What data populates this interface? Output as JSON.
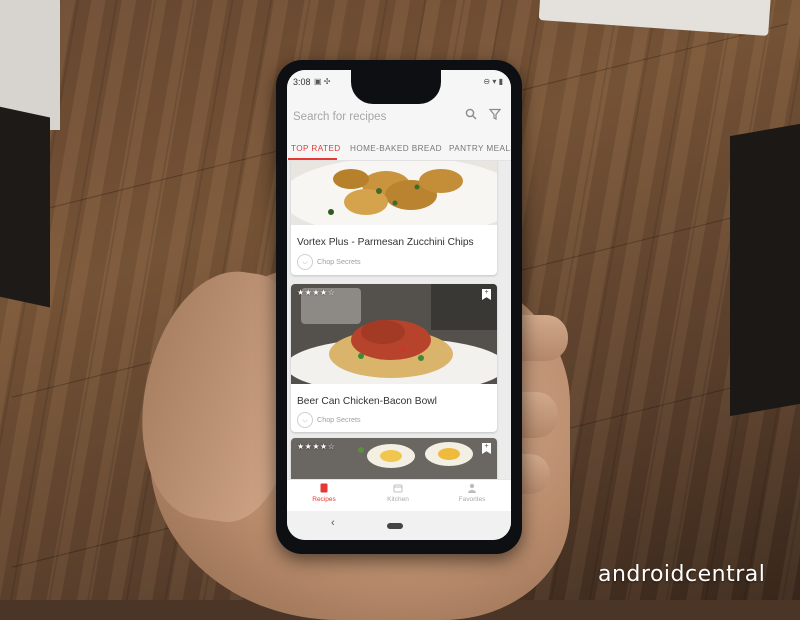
{
  "watermark": "androidcentral",
  "status_bar": {
    "time": "3:08",
    "left_icons": "▣ ✣",
    "right_icons": "⊖ ▾ ▮"
  },
  "search": {
    "placeholder": "Search for recipes"
  },
  "tabs": [
    {
      "label": "TOP RATED",
      "active": true
    },
    {
      "label": "HOME-BAKED BREAD",
      "active": false
    },
    {
      "label": "PANTRY MEALS",
      "active": false
    }
  ],
  "recipes": [
    {
      "title": "Vortex Plus - Parmesan Zucchini Chips",
      "author": "Chop Secrets"
    },
    {
      "title": "Beer Can Chicken-Bacon Bowl",
      "author": "Chop Secrets",
      "rating": "★★★★☆"
    },
    {
      "title": "",
      "author": "",
      "rating": "★★★★☆"
    }
  ],
  "bottom_nav": [
    {
      "label": "Recipes",
      "icon": "recipes-icon",
      "active": true
    },
    {
      "label": "Kitchen",
      "icon": "kitchen-icon",
      "active": false
    },
    {
      "label": "Favorites",
      "icon": "favorites-icon",
      "active": false
    }
  ],
  "system_nav": {
    "back": "‹"
  },
  "colors": {
    "accent": "#e53935",
    "screen_bg": "#f6f6f6",
    "card_bg": "#ffffff",
    "phone_body": "#0e0f12"
  }
}
